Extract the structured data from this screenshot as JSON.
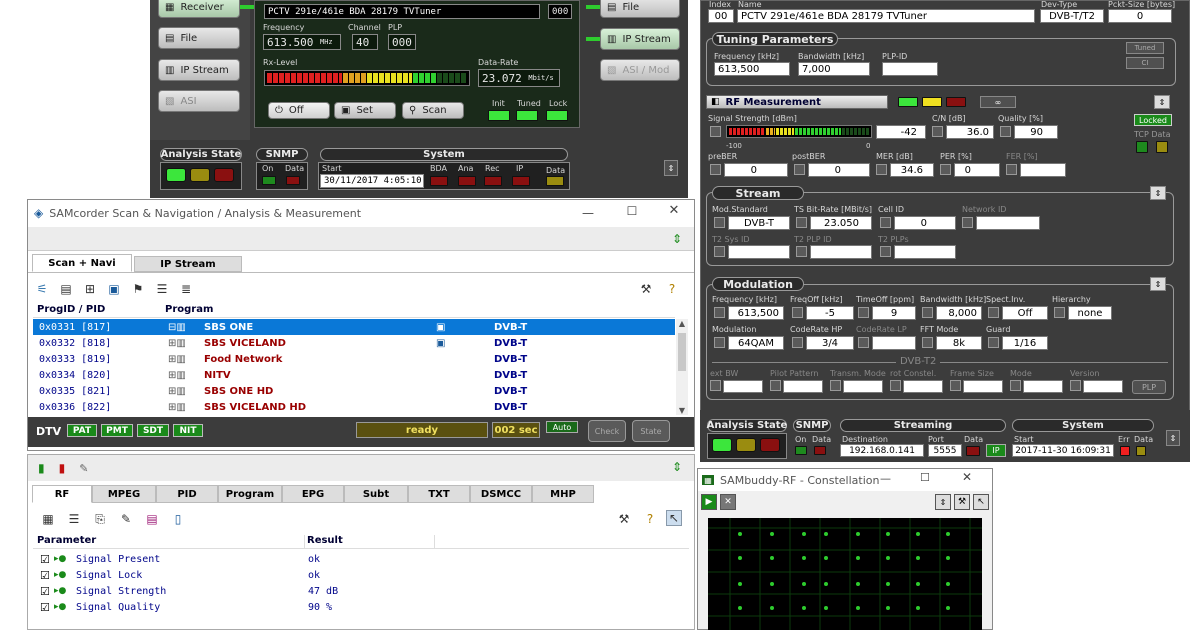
{
  "top_left": {
    "tuner_name": "PCTV 291e/461e BDA 28179 TVTuner",
    "tuner_index": "000",
    "freq_label": "Frequency",
    "freq_value": "613.500",
    "freq_unit": "MHz",
    "channel_label": "Channel",
    "channel_value": "40",
    "plp_label": "PLP",
    "plp_value": "000",
    "rxlevel_label": "Rx-Level",
    "datarate_label": "Data-Rate",
    "datarate_value": "23.072",
    "datarate_unit": "Mbit/s",
    "btn_off": "Off",
    "btn_set": "Set",
    "btn_scan": "Scan",
    "init_label": "Init",
    "tuned_label": "Tuned",
    "lock_label": "Lock",
    "side_buttons": [
      "Receiver",
      "File",
      "IP Stream",
      "ASI"
    ],
    "mid_buttons": [
      "File",
      "IP Stream",
      "ASI / Mod"
    ],
    "analysis_state": "Analysis State",
    "snmp": "SNMP",
    "snmp_on": "On",
    "snmp_data": "Data",
    "system": "System",
    "start_label": "Start",
    "start_value": "30/11/2017 4:05:10 P",
    "sys_labels": [
      "BDA",
      "Ana",
      "Rec",
      "IP",
      "Data"
    ]
  },
  "right_panel": {
    "index_label": "Index",
    "index_value": "00",
    "name_label": "Name",
    "name_value": "PCTV 291e/461e BDA 28179 TVTuner",
    "devtype_label": "Dev-Type",
    "devtype_value": "DVB-T/T2",
    "pcktsize_label": "Pckt-Size [bytes]",
    "pcktsize_value": "0",
    "tuning_header": "Tuning Parameters",
    "freq_khz_label": "Frequency [kHz]",
    "freq_khz_value": "613,500",
    "bw_label": "Bandwidth [kHz]",
    "bw_value": "7,000",
    "plpid_label": "PLP-ID",
    "plpid_value": "",
    "tuned_btn": "Tuned",
    "ci_btn": "CI",
    "rf_header": "RF Measurement",
    "signal_strength_label": "Signal Strength [dBm]",
    "signal_strength_value": "-42",
    "scale_min": "-100",
    "scale_max": "0",
    "cn_label": "C/N [dB]",
    "cn_value": "36.0",
    "quality_label": "Quality [%]",
    "quality_value": "90",
    "locked": "Locked",
    "tcp_data": "TCP Data",
    "preber_label": "preBER",
    "preber_value": "0",
    "postber_label": "postBER",
    "postber_value": "0",
    "mer_label": "MER [dB]",
    "mer_value": "34.6",
    "per_label": "PER [%]",
    "per_value": "0",
    "fer_label": "FER [%]",
    "fer_value": "",
    "stream_header": "Stream",
    "modstd_label": "Mod.Standard",
    "modstd_value": "DVB-T",
    "tsbitrate_label": "TS Bit-Rate [MBit/s]",
    "tsbitrate_value": "23.050",
    "cellid_label": "Cell ID",
    "cellid_value": "0",
    "networkid_label": "Network ID",
    "networkid_value": "",
    "t2sysid_label": "T2 Sys ID",
    "t2plpid_label": "T2 PLP ID",
    "t2plps_label": "T2 PLPs",
    "modulation_header": "Modulation",
    "m_freq_label": "Frequency [kHz]",
    "m_freq_value": "613,500",
    "freqoff_label": "FreqOff [kHz]",
    "freqoff_value": "-5",
    "timeoff_label": "TimeOff [ppm]",
    "timeoff_value": "9",
    "m_bw_label": "Bandwidth [kHz]",
    "m_bw_value": "8,000",
    "spectinv_label": "Spect.Inv.",
    "spectinv_value": "Off",
    "hierarchy_label": "Hierarchy",
    "hierarchy_value": "none",
    "modulation_label": "Modulation",
    "modulation_value": "64QAM",
    "coderatehp_label": "CodeRate HP",
    "coderatehp_value": "3/4",
    "coderatelp_label": "CodeRate LP",
    "coderatelp_value": "",
    "fftmode_label": "FFT Mode",
    "fftmode_value": "8k",
    "guard_label": "Guard",
    "guard_value": "1/16",
    "dvbt2_label": "DVB-T2",
    "t2_labels": [
      "ext BW",
      "Pilot Pattern",
      "Transm. Mode",
      "rot Constel.",
      "Frame Size",
      "Mode",
      "Version"
    ],
    "plp_btn": "PLP",
    "analysis_state": "Analysis State",
    "snmp": "SNMP",
    "snmp_on": "On",
    "snmp_data": "Data",
    "streaming": "Streaming",
    "dest_label": "Destination",
    "dest_value": "192.168.0.141",
    "port_label": "Port",
    "port_value": "5555",
    "data_label": "Data",
    "ip_label": "IP",
    "system": "System",
    "start_label": "Start",
    "start_value": "2017-11-30 16:09:31",
    "err_label": "Err",
    "sys_data_label": "Data"
  },
  "scan_window": {
    "title": "SAMcorder Scan & Navigation / Analysis & Measurement",
    "tabs": [
      "Scan + Navi",
      "IP Stream"
    ],
    "col_progid": "ProgID / PID",
    "col_program": "Program",
    "rows": [
      {
        "id": "0x0331 [817]",
        "name": "SBS ONE",
        "std": "DVB-T"
      },
      {
        "id": "0x0332 [818]",
        "name": "SBS VICELAND",
        "std": "DVB-T"
      },
      {
        "id": "0x0333 [819]",
        "name": "Food Network",
        "std": "DVB-T"
      },
      {
        "id": "0x0334 [820]",
        "name": "NITV",
        "std": "DVB-T"
      },
      {
        "id": "0x0335 [821]",
        "name": "SBS ONE HD",
        "std": "DVB-T"
      },
      {
        "id": "0x0336 [822]",
        "name": "SBS VICELAND HD",
        "std": "DVB-T"
      }
    ],
    "dtv": "DTV",
    "pat": "PAT",
    "pmt": "PMT",
    "sdt": "SDT",
    "nit": "NIT",
    "status": "ready",
    "secs": "002 sec",
    "auto": "Auto",
    "check": "Check",
    "state": "State"
  },
  "analysis": {
    "tabs": [
      "RF",
      "MPEG",
      "PID",
      "Program",
      "EPG",
      "Subt",
      "TXT",
      "DSMCC",
      "MHP"
    ],
    "col_param": "Parameter",
    "col_result": "Result",
    "rows": [
      {
        "param": "Signal Present",
        "result": "ok"
      },
      {
        "param": "Signal Lock",
        "result": "ok"
      },
      {
        "param": "Signal Strength",
        "result": "47 dB"
      },
      {
        "param": "Signal Quality",
        "result": "90 %"
      }
    ]
  },
  "constellation": {
    "title": "SAMbuddy-RF - Constellation"
  }
}
